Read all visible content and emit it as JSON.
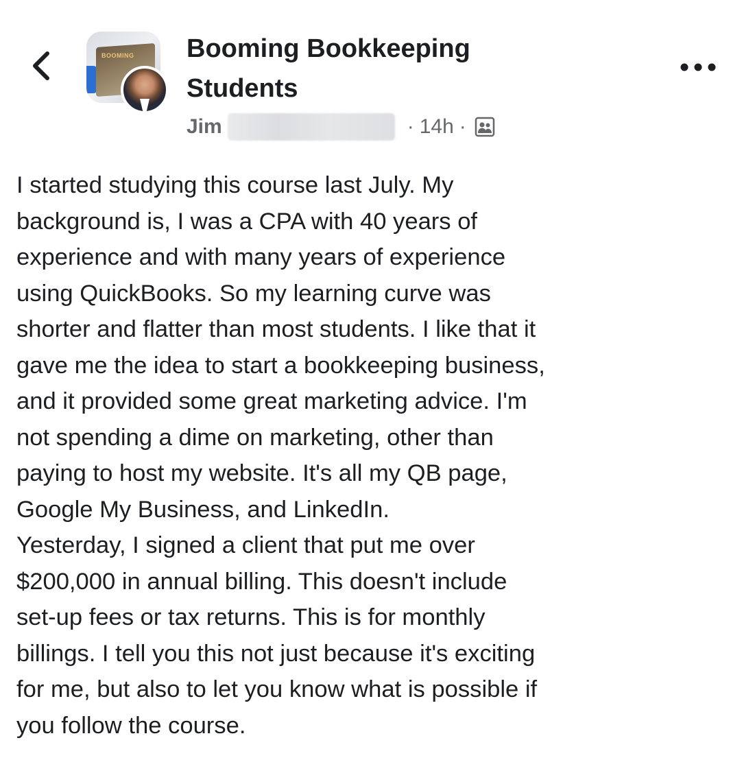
{
  "group": {
    "name": "Booming Bookkeeping Students",
    "avatar_label": "BOOMING",
    "avatar_icon": "group-avatar-icon"
  },
  "post_meta": {
    "author": "Jim",
    "separator": "·",
    "time": "14h",
    "audience_icon": "group-members-icon"
  },
  "controls": {
    "back_icon": "chevron-left-icon",
    "more_icon": "more-options-icon"
  },
  "post": {
    "paragraph_1": "I started studying this course last July. My\nbackground is, I was a CPA with 40 years of\nexperience and with many years of experience\nusing QuickBooks. So my learning curve was\nshorter and flatter than most students. I like that it\ngave me the idea to start a bookkeeping business,\nand it provided some great marketing advice. I'm\nnot spending a dime on marketing, other than\npaying to host my website. It's all my QB page,\nGoogle My Business, and LinkedIn.",
    "paragraph_2": "Yesterday, I signed a client that put me over\n$200,000 in annual billing. This doesn't include\nset-up fees or tax returns. This is for monthly\nbillings. I tell you this not just because it's exciting\nfor me, but also to let you know what is possible if\nyou follow the course."
  },
  "colors": {
    "text_primary": "#1c1e21",
    "text_secondary": "#65676b",
    "background": "#ffffff"
  }
}
